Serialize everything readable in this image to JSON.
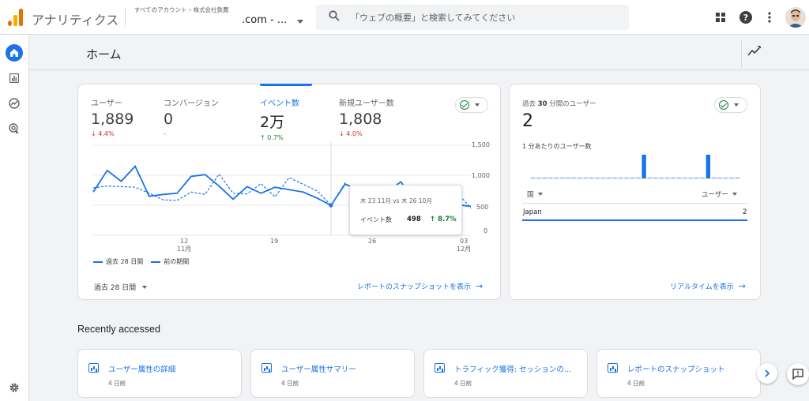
{
  "colors": {
    "accent": "#1a73e8",
    "up": "#188038",
    "down": "#d93025",
    "logo_orange": "#f9ab00",
    "logo_dark_orange": "#e37400"
  },
  "header": {
    "app_title": "アナリティクス",
    "breadcrumb_root": "すべてのアカウント",
    "breadcrumb_account": "株式会社鉄鷹",
    "property_name": ".com - ...",
    "search_placeholder": "「ウェブの概要」と検索してみてください",
    "icons": [
      "apps-icon",
      "help-icon",
      "more-vert-icon"
    ]
  },
  "nav": {
    "items": [
      {
        "name": "home",
        "icon": "home-icon",
        "active": true
      },
      {
        "name": "reports",
        "icon": "bar-chart-icon",
        "active": false
      },
      {
        "name": "explore",
        "icon": "explore-icon",
        "active": false
      },
      {
        "name": "advertising",
        "icon": "ads-icon",
        "active": false
      }
    ],
    "settings_icon": "gear-icon"
  },
  "page": {
    "title": "ホーム"
  },
  "overview": {
    "metrics": [
      {
        "label": "ユーザー",
        "value": "1,889",
        "delta": "4.4%",
        "direction": "down",
        "active": false
      },
      {
        "label": "コンバージョン",
        "value": "0",
        "delta": "-",
        "direction": "none",
        "active": false
      },
      {
        "label": "イベント数",
        "value": "2万",
        "delta": "0.7%",
        "direction": "up",
        "active": true
      },
      {
        "label": "新規ユーザー数",
        "value": "1,808",
        "delta": "4.0%",
        "direction": "down",
        "active": false
      }
    ],
    "legend_current": "過去 28 日間",
    "legend_previous": "前の期間",
    "date_range": "過去 28 日間",
    "snapshot_link": "レポートのスナップショットを表示",
    "tooltip": {
      "date_range": "木 23 11月 vs 木 26 10月",
      "metric": "イベント数",
      "value": "498",
      "delta": "8.7%"
    }
  },
  "chart_data": {
    "type": "line",
    "y_ticks": [
      "1,500",
      "1,000",
      "500",
      "0"
    ],
    "x_ticks": [
      {
        "day": "12",
        "month": "11月"
      },
      {
        "day": "19",
        "month": ""
      },
      {
        "day": "26",
        "month": ""
      },
      {
        "day": "03",
        "month": "12月"
      }
    ],
    "ylim": [
      0,
      1500
    ],
    "series": [
      {
        "name": "過去 28 日間",
        "style": "solid",
        "values": [
          720,
          1080,
          900,
          1150,
          650,
          680,
          700,
          980,
          1010,
          820,
          600,
          810,
          700,
          800,
          760,
          720,
          620,
          498,
          850,
          760,
          720,
          730,
          890,
          560,
          600,
          520,
          510,
          480
        ]
      },
      {
        "name": "前の期間",
        "style": "dashed",
        "values": [
          790,
          820,
          810,
          800,
          700,
          590,
          580,
          720,
          680,
          1020,
          700,
          690,
          860,
          640,
          960,
          850,
          740,
          500,
          870,
          720,
          810,
          780,
          760,
          600,
          570,
          840,
          720,
          450
        ]
      }
    ]
  },
  "realtime": {
    "title_prefix": "過去",
    "title_number": "30",
    "title_suffix": "分間のユーザー",
    "count": "2",
    "per_minute_label": "1 分あたりのユーザー数",
    "col_country": "国",
    "col_users": "ユーザー",
    "rows": [
      {
        "country": "Japan",
        "users": "2"
      }
    ],
    "link": "リアルタイムを表示"
  },
  "realtime_chart": {
    "type": "bar",
    "values": [
      0,
      0,
      0,
      0,
      0,
      0,
      0,
      0,
      0,
      0,
      0,
      0,
      0,
      0,
      0,
      0,
      0,
      0,
      0,
      1,
      0,
      0,
      0,
      0,
      0,
      0,
      0,
      0,
      0,
      0,
      1,
      0,
      0,
      0,
      0,
      0
    ]
  },
  "recent": {
    "title": "Recently accessed",
    "items": [
      {
        "title": "ユーザー属性の詳細",
        "meta": "4 日前"
      },
      {
        "title": "ユーザー属性サマリー",
        "meta": "4 日前"
      },
      {
        "title": "トラフィック獲得: セッションの...",
        "meta": "4 日前"
      },
      {
        "title": "レポートのスナップショット",
        "meta": "4 日前"
      }
    ]
  }
}
